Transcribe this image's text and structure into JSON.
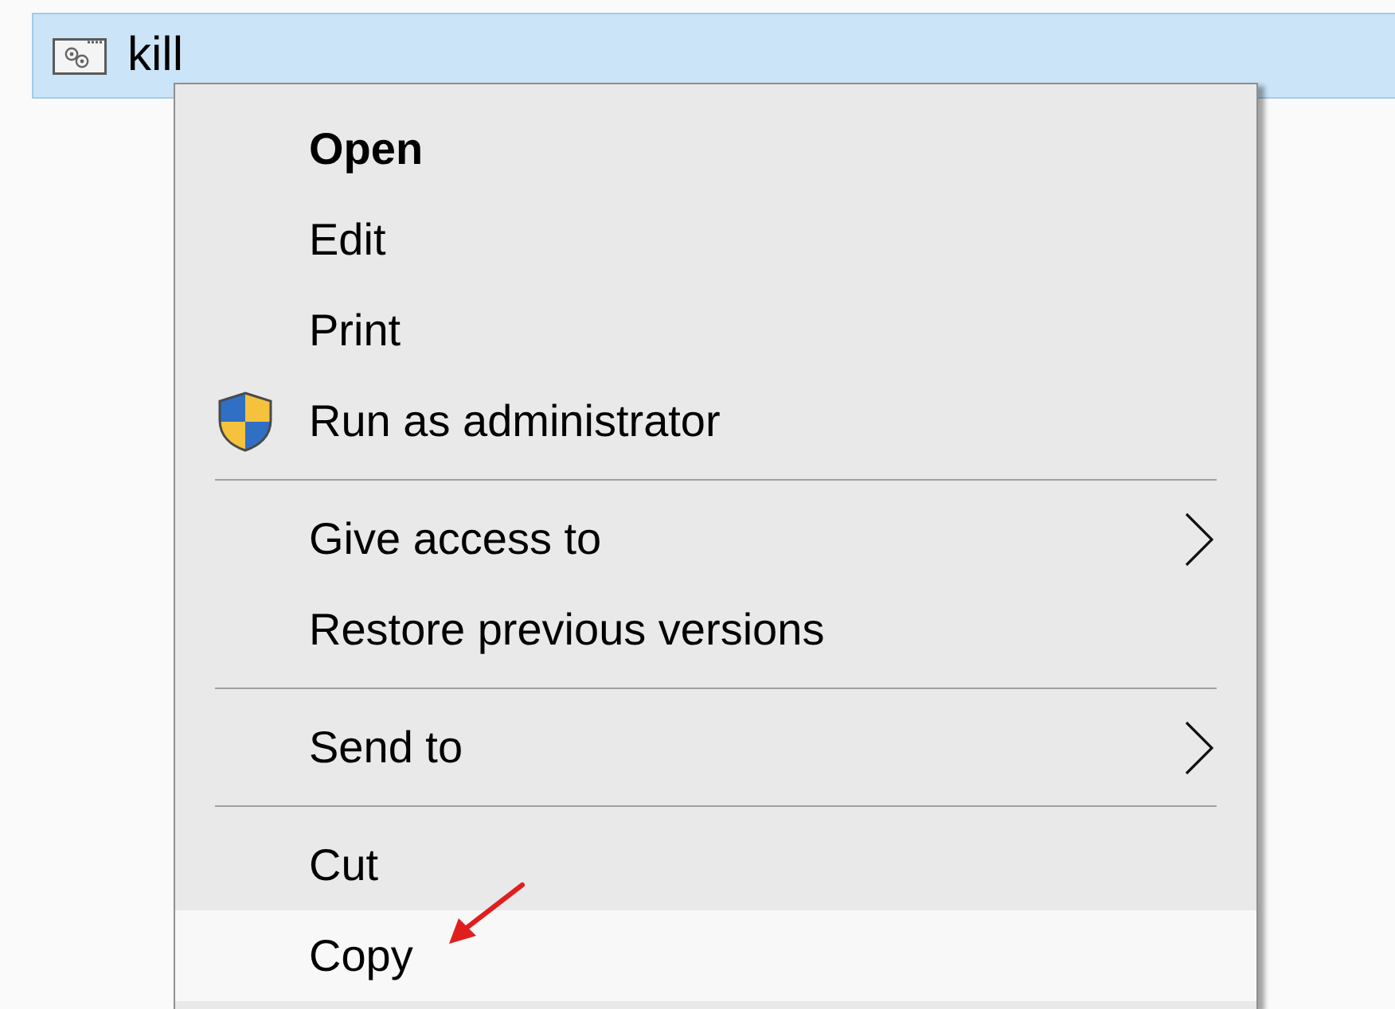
{
  "file": {
    "name": "kill",
    "selected": true
  },
  "context_menu": {
    "groups": [
      [
        {
          "label": "Open",
          "default": true,
          "elevated": false,
          "submenu": false,
          "selected": false
        },
        {
          "label": "Edit",
          "default": false,
          "elevated": false,
          "submenu": false,
          "selected": false
        },
        {
          "label": "Print",
          "default": false,
          "elevated": false,
          "submenu": false,
          "selected": false
        },
        {
          "label": "Run as administrator",
          "default": false,
          "elevated": true,
          "submenu": false,
          "selected": false
        }
      ],
      [
        {
          "label": "Give access to",
          "default": false,
          "elevated": false,
          "submenu": true,
          "selected": false
        },
        {
          "label": "Restore previous versions",
          "default": false,
          "elevated": false,
          "submenu": false,
          "selected": false
        }
      ],
      [
        {
          "label": "Send to",
          "default": false,
          "elevated": false,
          "submenu": true,
          "selected": false
        }
      ],
      [
        {
          "label": "Cut",
          "default": false,
          "elevated": false,
          "submenu": false,
          "selected": false
        },
        {
          "label": "Copy",
          "default": false,
          "elevated": false,
          "submenu": false,
          "selected": true
        }
      ]
    ]
  }
}
